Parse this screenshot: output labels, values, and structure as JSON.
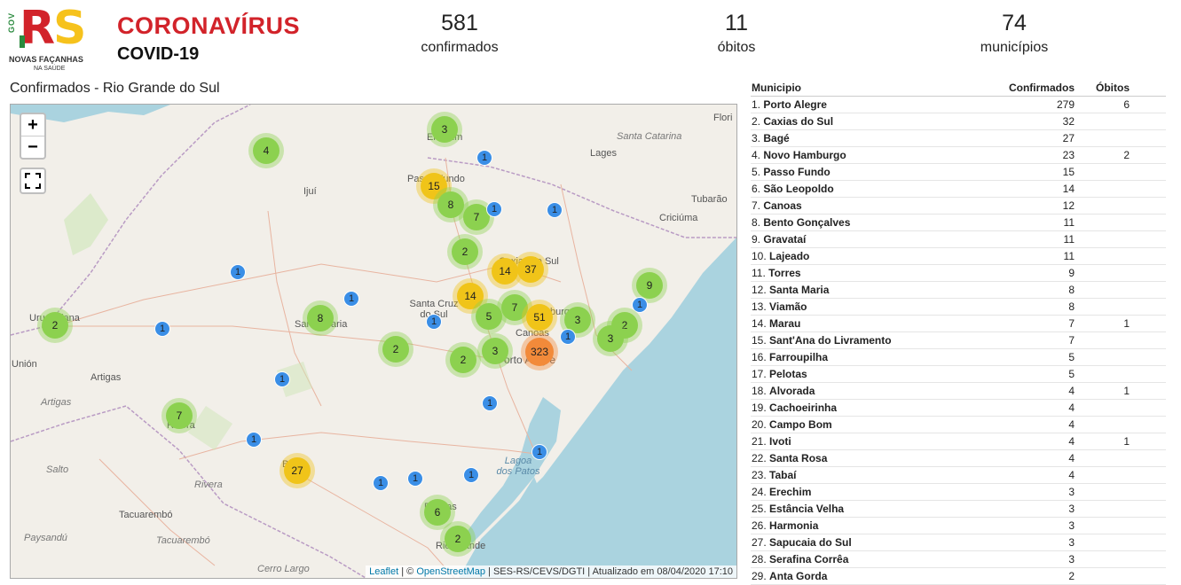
{
  "header": {
    "logo": {
      "gov": "GOV",
      "rs": "RS",
      "tagline": "NOVAS FAÇANHAS",
      "subtagline": "NA SAÚDE"
    },
    "title": "CORONAVÍRUS",
    "subtitle": "COVID-19"
  },
  "stats": [
    {
      "value": "581",
      "label": "confirmados"
    },
    {
      "value": "11",
      "label": "óbitos"
    },
    {
      "value": "74",
      "label": "municípios"
    }
  ],
  "map": {
    "title": "Confirmados - Rio Grande do Sul",
    "zoom_in": "+",
    "zoom_out": "−",
    "attribution": {
      "leaflet": "Leaflet",
      "osm_prefix": " | © ",
      "osm": "OpenStreetMap",
      "suffix": " | SES-RS/CEVS/DGTI | Atualizado em 08/04/2020 17:10"
    },
    "labels": {
      "flori": "Flori",
      "santa_catarina": "Santa Catarina",
      "lages": "Lages",
      "erechim": "Erechim",
      "passo_fundo": "Passo Fundo",
      "ijui": "Ijuí",
      "tubarao": "Tubarão",
      "criciuma": "Criciúma",
      "caxias": "Caxias do Sul",
      "santa_cruz": "Santa Cruz do Sul",
      "uruguaiana": "Uruguaiana",
      "santa_maria": "Santa Maria",
      "union": "Unión",
      "artigas1": "Artigas",
      "artigas2": "Artigas",
      "canoas": "Canoas",
      "porto_alegre": "Porto Alegre",
      "novo_hamburgo": "Novo Hamburgo",
      "rivera1": "Rivera",
      "rivera2": "Rivera",
      "salto": "Salto",
      "lagoa": "Lagoa dos Patos",
      "tacuarembo1": "Tacuarembó",
      "tacuarembo2": "Tacuarembó",
      "paysandu": "Paysandú",
      "pelotas": "Pelotas",
      "rio_grande": "Rio Grande",
      "cerro_largo": "Cerro Largo",
      "bage": "Bagé"
    },
    "clusters": [
      {
        "count": "3",
        "size": "small"
      },
      {
        "count": "4",
        "size": "small"
      },
      {
        "count": "1",
        "size": "single"
      },
      {
        "count": "15",
        "size": "medium"
      },
      {
        "count": "8",
        "size": "small"
      },
      {
        "count": "7",
        "size": "small"
      },
      {
        "count": "1",
        "size": "single"
      },
      {
        "count": "1",
        "size": "single"
      },
      {
        "count": "2",
        "size": "small"
      },
      {
        "count": "14",
        "size": "medium"
      },
      {
        "count": "37",
        "size": "medium"
      },
      {
        "count": "1",
        "size": "single"
      },
      {
        "count": "1",
        "size": "single"
      },
      {
        "count": "9",
        "size": "small"
      },
      {
        "count": "14",
        "size": "medium"
      },
      {
        "count": "8",
        "size": "small"
      },
      {
        "count": "7",
        "size": "small"
      },
      {
        "count": "51",
        "size": "medium"
      },
      {
        "count": "3",
        "size": "small"
      },
      {
        "count": "1",
        "size": "single"
      },
      {
        "count": "2",
        "size": "small"
      },
      {
        "count": "1",
        "size": "single"
      },
      {
        "count": "5",
        "size": "small"
      },
      {
        "count": "1",
        "size": "single"
      },
      {
        "count": "2",
        "size": "small"
      },
      {
        "count": "1",
        "size": "single"
      },
      {
        "count": "2",
        "size": "small"
      },
      {
        "count": "3",
        "size": "small"
      },
      {
        "count": "323",
        "size": "large"
      },
      {
        "count": "1",
        "size": "single"
      },
      {
        "count": "3",
        "size": "small"
      },
      {
        "count": "2",
        "size": "small"
      },
      {
        "count": "1",
        "size": "single"
      },
      {
        "count": "7",
        "size": "small"
      },
      {
        "count": "1",
        "size": "single"
      },
      {
        "count": "1",
        "size": "single"
      },
      {
        "count": "27",
        "size": "medium"
      },
      {
        "count": "1",
        "size": "single"
      },
      {
        "count": "1",
        "size": "single"
      },
      {
        "count": "1",
        "size": "single"
      },
      {
        "count": "6",
        "size": "small"
      },
      {
        "count": "2",
        "size": "small"
      }
    ]
  },
  "table": {
    "headers": {
      "municipio": "Municipio",
      "confirmados": "Confirmados",
      "obitos": "Óbitos"
    },
    "rows": [
      {
        "rank": "1.",
        "name": "Porto Alegre",
        "confirmados": "279",
        "obitos": "6"
      },
      {
        "rank": "2.",
        "name": "Caxias do Sul",
        "confirmados": "32",
        "obitos": ""
      },
      {
        "rank": "3.",
        "name": "Bagé",
        "confirmados": "27",
        "obitos": ""
      },
      {
        "rank": "4.",
        "name": "Novo Hamburgo",
        "confirmados": "23",
        "obitos": "2"
      },
      {
        "rank": "5.",
        "name": "Passo Fundo",
        "confirmados": "15",
        "obitos": ""
      },
      {
        "rank": "6.",
        "name": "São Leopoldo",
        "confirmados": "14",
        "obitos": ""
      },
      {
        "rank": "7.",
        "name": "Canoas",
        "confirmados": "12",
        "obitos": ""
      },
      {
        "rank": "8.",
        "name": "Bento Gonçalves",
        "confirmados": "11",
        "obitos": ""
      },
      {
        "rank": "9.",
        "name": "Gravataí",
        "confirmados": "11",
        "obitos": ""
      },
      {
        "rank": "10.",
        "name": "Lajeado",
        "confirmados": "11",
        "obitos": ""
      },
      {
        "rank": "11.",
        "name": "Torres",
        "confirmados": "9",
        "obitos": ""
      },
      {
        "rank": "12.",
        "name": "Santa Maria",
        "confirmados": "8",
        "obitos": ""
      },
      {
        "rank": "13.",
        "name": "Viamão",
        "confirmados": "8",
        "obitos": ""
      },
      {
        "rank": "14.",
        "name": "Marau",
        "confirmados": "7",
        "obitos": "1"
      },
      {
        "rank": "15.",
        "name": "Sant'Ana do Livramento",
        "confirmados": "7",
        "obitos": ""
      },
      {
        "rank": "16.",
        "name": "Farroupilha",
        "confirmados": "5",
        "obitos": ""
      },
      {
        "rank": "17.",
        "name": "Pelotas",
        "confirmados": "5",
        "obitos": ""
      },
      {
        "rank": "18.",
        "name": "Alvorada",
        "confirmados": "4",
        "obitos": "1"
      },
      {
        "rank": "19.",
        "name": "Cachoeirinha",
        "confirmados": "4",
        "obitos": ""
      },
      {
        "rank": "20.",
        "name": "Campo Bom",
        "confirmados": "4",
        "obitos": ""
      },
      {
        "rank": "21.",
        "name": "Ivoti",
        "confirmados": "4",
        "obitos": "1"
      },
      {
        "rank": "22.",
        "name": "Santa Rosa",
        "confirmados": "4",
        "obitos": ""
      },
      {
        "rank": "23.",
        "name": "Tabaí",
        "confirmados": "4",
        "obitos": ""
      },
      {
        "rank": "24.",
        "name": "Erechim",
        "confirmados": "3",
        "obitos": ""
      },
      {
        "rank": "25.",
        "name": "Estância Velha",
        "confirmados": "3",
        "obitos": ""
      },
      {
        "rank": "26.",
        "name": "Harmonia",
        "confirmados": "3",
        "obitos": ""
      },
      {
        "rank": "27.",
        "name": "Sapucaia do Sul",
        "confirmados": "3",
        "obitos": ""
      },
      {
        "rank": "28.",
        "name": "Serafina Corrêa",
        "confirmados": "3",
        "obitos": ""
      },
      {
        "rank": "29.",
        "name": "Anta Gorda",
        "confirmados": "2",
        "obitos": ""
      }
    ]
  },
  "colors": {
    "cluster_small": "#8cd14f",
    "cluster_medium": "#f0c419",
    "cluster_large": "#f28a3a",
    "marker_single": "#3a8ee6",
    "ocean": "#aad3df"
  }
}
